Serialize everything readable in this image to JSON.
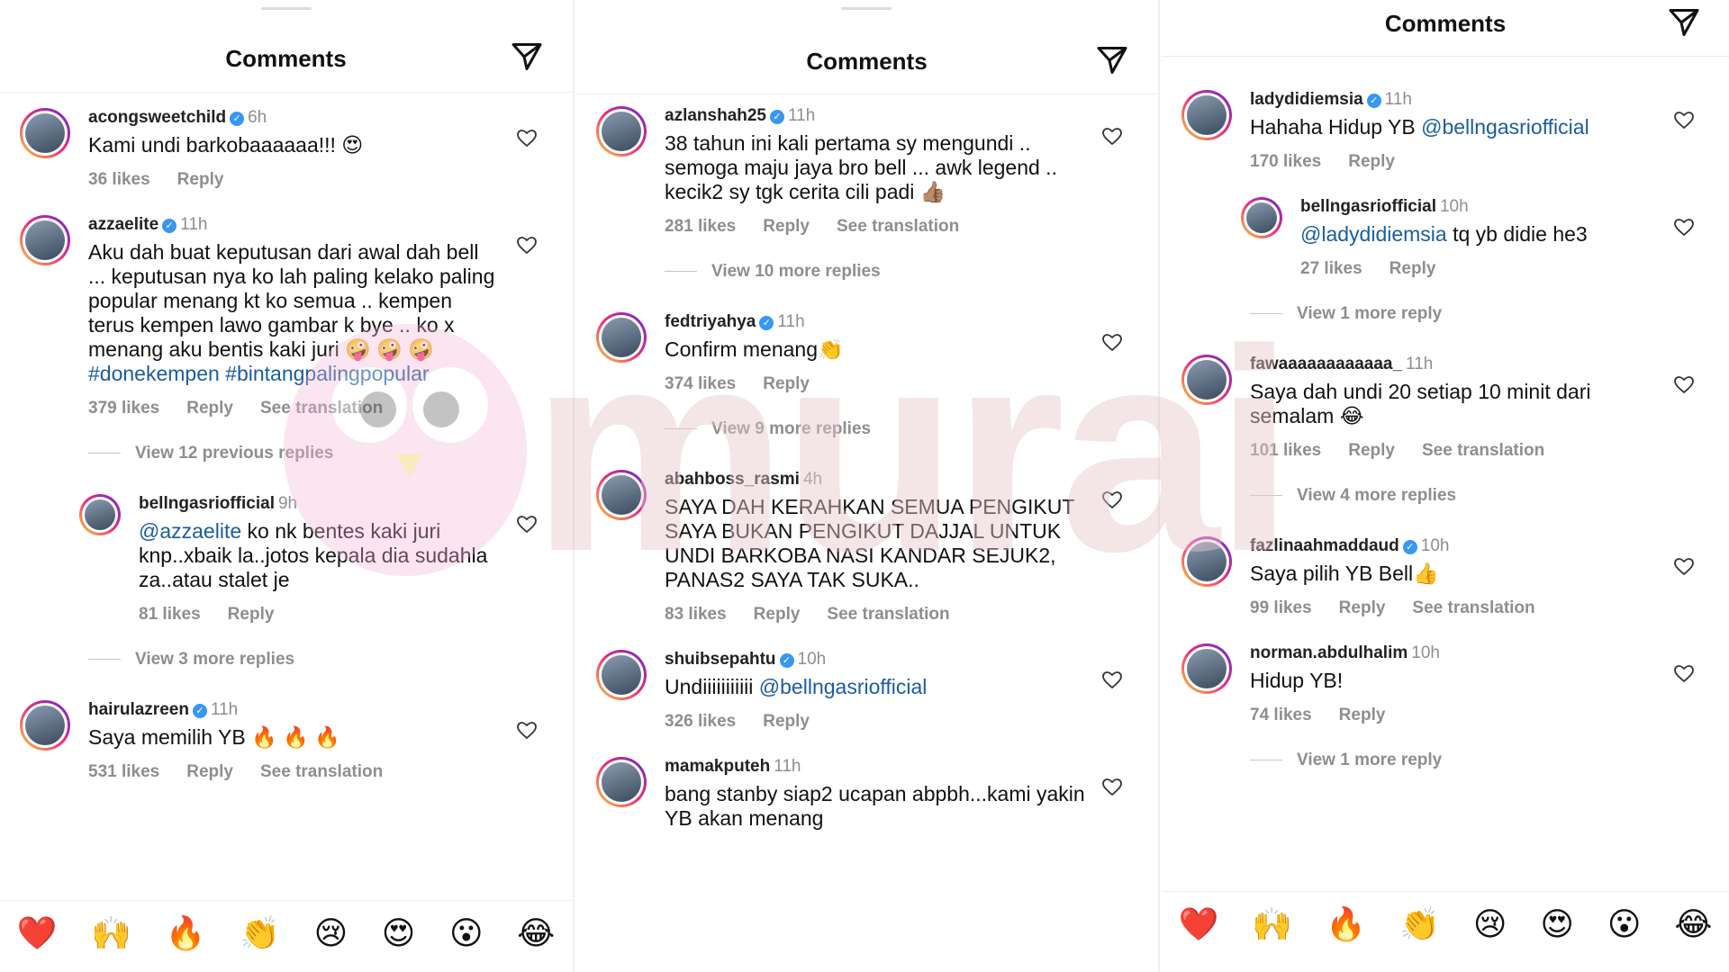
{
  "colors": {
    "mention": "#1b5d9e",
    "meta": "#8e8e8e",
    "verified": "#3897f0",
    "heart_red": "#e0245e"
  },
  "panels": [
    {
      "header_title": "Comments",
      "comments": [
        {
          "user": "acongsweetchild",
          "verified": true,
          "time": "6h",
          "text": "Kami undi barkobaaaaaa!!! 😍",
          "likes": "36 likes",
          "reply": "Reply",
          "translation": ""
        },
        {
          "user": "azzaelite",
          "verified": true,
          "time": "11h",
          "text": "Aku dah buat keputusan dari awal dah bell ... keputusan nya ko lah paling kelako paling popular menang kt ko semua .. kempen terus kempen lawo gambar k bye .. ko x menang aku bentis kaki juri 🤪 🤪 🤪 ",
          "mention": "#donekempen #bintangpalingpopular",
          "likes": "379 likes",
          "reply": "Reply",
          "translation": "See translation"
        },
        {
          "type": "view",
          "label": "View 12 previous replies"
        },
        {
          "user": "bellngasriofficial",
          "verified": false,
          "time": "9h",
          "reply_to": true,
          "mention_lead": "@azzaelite",
          "text": " ko nk bentes kaki juri knp..xbaik la..jotos kepala dia sudahla za..atau stalet je",
          "likes": "81 likes",
          "reply": "Reply",
          "translation": ""
        },
        {
          "type": "view",
          "label": "View 3 more replies"
        },
        {
          "user": "hairulazreen",
          "verified": true,
          "time": "11h",
          "text": "Saya memilih YB 🔥 🔥 🔥",
          "likes": "531 likes",
          "reply": "Reply",
          "translation": "See translation"
        }
      ],
      "emojis": [
        "❤️",
        "🙌",
        "🔥",
        "👏",
        "😢",
        "😍",
        "😮",
        "😂"
      ]
    },
    {
      "header_title": "Comments",
      "comments": [
        {
          "user": "azlanshah25",
          "verified": true,
          "time": "11h",
          "text": "38 tahun ini kali pertama sy mengundi .. semoga maju jaya bro bell ... awk legend .. kecik2 sy tgk cerita cili padi 👍🏽",
          "likes": "281 likes",
          "reply": "Reply",
          "translation": "See translation"
        },
        {
          "type": "view",
          "label": "View 10 more replies"
        },
        {
          "user": "fedtriyahya",
          "verified": true,
          "time": "11h",
          "text": "Confirm menang👏",
          "likes": "374 likes",
          "reply": "Reply",
          "translation": ""
        },
        {
          "type": "view",
          "label": "View 9 more replies"
        },
        {
          "user": "abahboss_rasmi",
          "verified": false,
          "time": "4h",
          "text": "SAYA DAH KERAHKAN SEMUA PENGIKUT SAYA BUKAN PENGIKUT DAJJAL UNTUK UNDI BARKOBA NASI KANDAR SEJUK2, PANAS2 SAYA TAK SUKA..",
          "likes": "83 likes",
          "reply": "Reply",
          "translation": "See translation"
        },
        {
          "user": "shuibsepahtu",
          "verified": true,
          "time": "10h",
          "text": "Undiiiiiiiiiii ",
          "mention": "@bellngasriofficial",
          "likes": "326 likes",
          "reply": "Reply",
          "translation": ""
        },
        {
          "user": "mamakputeh",
          "verified": false,
          "time": "11h",
          "text": "bang stanby siap2 ucapan abpbh...kami yakin YB akan menang",
          "likes": "",
          "reply": "",
          "translation": ""
        }
      ],
      "emojis": []
    },
    {
      "header_title": "Comments",
      "comments": [
        {
          "user": "ladydidiemsia",
          "verified": true,
          "time": "11h",
          "text": "Hahaha Hidup YB ",
          "mention": "@bellngasriofficial",
          "likes": "170 likes",
          "reply": "Reply",
          "translation": ""
        },
        {
          "user": "bellngasriofficial",
          "verified": false,
          "time": "10h",
          "reply_to": true,
          "mention_lead": "@ladydidiemsia",
          "text": " tq yb didie he3",
          "likes": "27 likes",
          "reply": "Reply",
          "translation": ""
        },
        {
          "type": "view",
          "label": "View 1 more reply"
        },
        {
          "user": "fawaaaaaaaaaaaa_",
          "verified": false,
          "time": "11h",
          "text": "Saya dah undi 20 setiap 10 minit dari semalam 😂",
          "likes": "101 likes",
          "reply": "Reply",
          "translation": "See translation"
        },
        {
          "type": "view",
          "label": "View 4 more replies"
        },
        {
          "user": "fazlinaahmaddaud",
          "verified": true,
          "time": "10h",
          "text": "Saya pilih YB Bell👍",
          "likes": "99 likes",
          "reply": "Reply",
          "translation": "See translation"
        },
        {
          "user": "norman.abdulhalim",
          "verified": false,
          "time": "10h",
          "text": "Hidup YB!",
          "likes": "74 likes",
          "reply": "Reply",
          "translation": ""
        },
        {
          "type": "view",
          "label": "View 1 more reply"
        }
      ],
      "emojis": [
        "❤️",
        "🙌",
        "🔥",
        "👏",
        "😢",
        "😍",
        "😮",
        "😂"
      ]
    }
  ],
  "watermark_text": "murai"
}
